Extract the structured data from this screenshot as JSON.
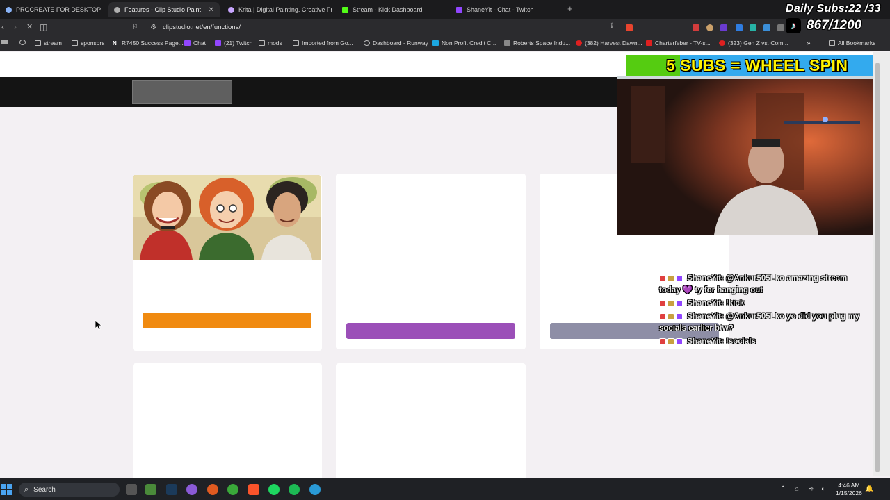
{
  "tabs": [
    {
      "label": "PROCREATE FOR DESKTOP - Google",
      "favicon_color": "#8ab4f8",
      "active": false
    },
    {
      "label": "Features - Clip Studio Paint",
      "favicon_color": "#b0b0b0",
      "active": true
    },
    {
      "label": "Krita | Digital Painting. Creative Freed",
      "favicon_color": "#c8a6ff",
      "active": false
    },
    {
      "label": "Stream - Kick Dashboard",
      "favicon_color": "#53fc18",
      "active": false
    },
    {
      "label": "ShaneYit - Chat - Twitch",
      "favicon_color": "#9146ff",
      "active": false
    }
  ],
  "address_bar": {
    "url": "clipstudio.net/en/functions/"
  },
  "bookmarks": [
    {
      "label": "stream",
      "icon": "folder-icon"
    },
    {
      "label": "sponsors",
      "icon": "folder-icon"
    },
    {
      "label": "R7450 Success Page...",
      "icon": "n-icon"
    },
    {
      "label": "Chat",
      "icon": "twitch-icon"
    },
    {
      "label": "(21) Twitch",
      "icon": "twitch-icon"
    },
    {
      "label": "mods",
      "icon": "folder-icon"
    },
    {
      "label": "Imported from Go...",
      "icon": "folder-icon"
    },
    {
      "label": "Dashboard - Runway",
      "icon": "runway-icon"
    },
    {
      "label": "Non Profit Credit C...",
      "icon": "n-icon"
    },
    {
      "label": "Roberts Space Indu...",
      "icon": "rsi-icon"
    },
    {
      "label": "(382) Harvest Dawn...",
      "icon": "youtube-icon"
    },
    {
      "label": "Charterfeber - TV-s...",
      "icon": "play-icon"
    },
    {
      "label": "(323) Gen Z vs. Com...",
      "icon": "youtube-icon"
    }
  ],
  "all_bookmarks_label": "All Bookmarks",
  "page": {
    "card_buttons": [
      {
        "color": "#f08a10"
      },
      {
        "color": "#9b4fb8"
      },
      {
        "color": "#8e8ea6"
      }
    ]
  },
  "overlay": {
    "daily_subs": "Daily Subs:22 /33",
    "tiktok_count": "867/1200",
    "wheel_banner": "5 SUBS = WHEEL SPIN",
    "wheel_progress": 0.22,
    "chat": [
      {
        "user": "ShaneYit:",
        "message": "@Ankur505Lko amazing stream today 💜 ty for hanging out"
      },
      {
        "user": "ShaneYit:",
        "message": "!kick"
      },
      {
        "user": "ShaneYit:",
        "message": "@Ankur505Lko yo did you plug my socials earlier btw?"
      },
      {
        "user": "ShaneYit:",
        "message": "!socials"
      }
    ]
  },
  "taskbar": {
    "search_label": "Search",
    "time": "4:46 AM",
    "date": "1/15/2026"
  }
}
